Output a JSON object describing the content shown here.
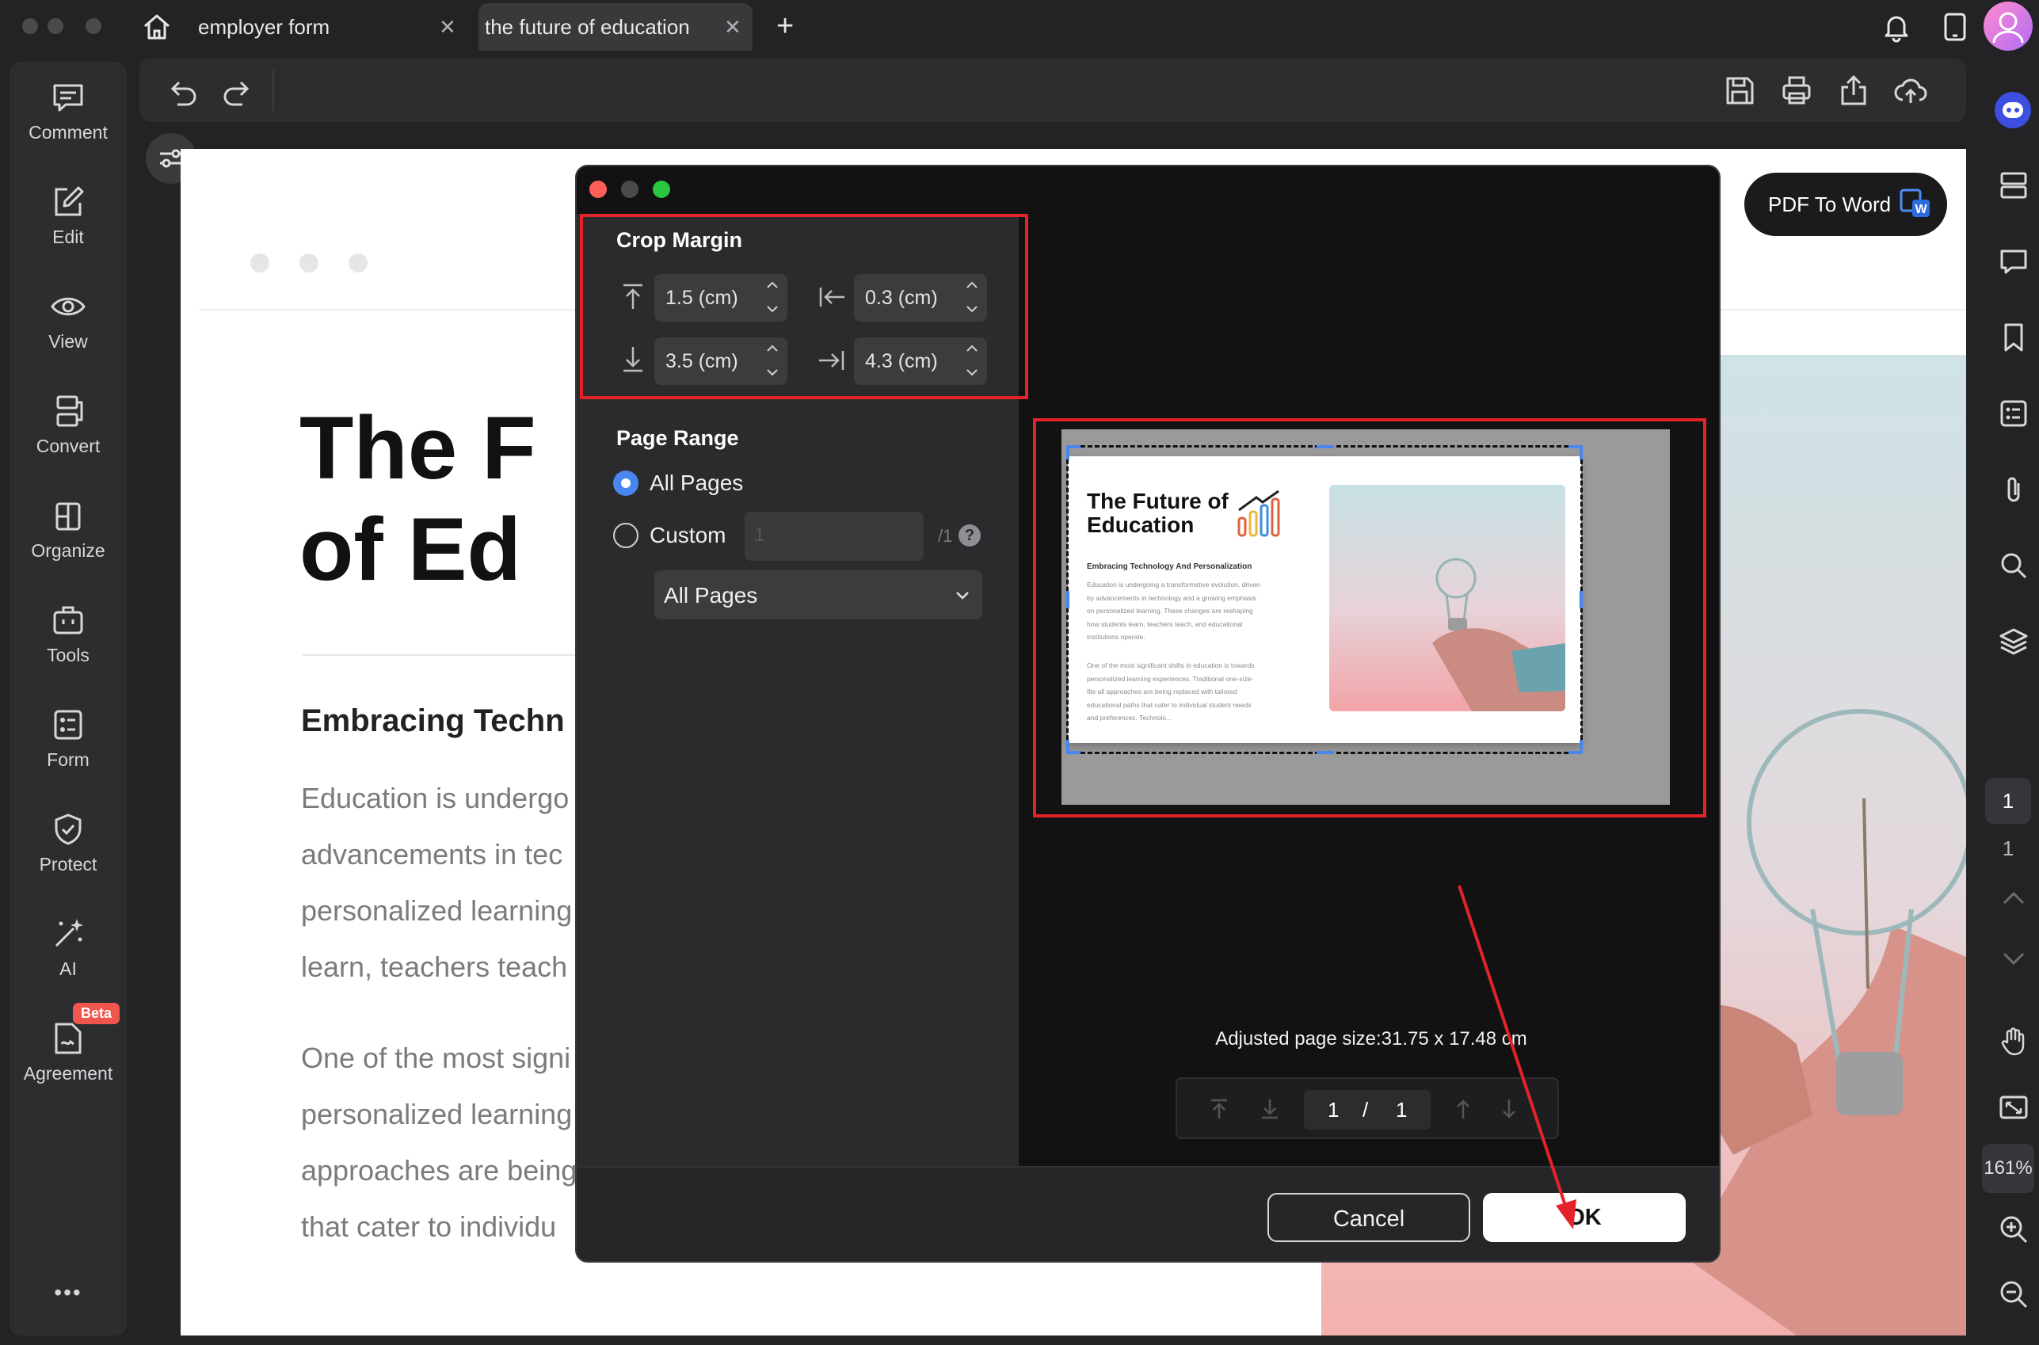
{
  "tabs": [
    {
      "title": "employer form",
      "close": "✕"
    },
    {
      "title": "the future of education",
      "close": "✕"
    }
  ],
  "new_tab": "+",
  "sidebar": {
    "items": [
      {
        "label": "Comment",
        "icon": "comment-icon"
      },
      {
        "label": "Edit",
        "icon": "edit-icon"
      },
      {
        "label": "View",
        "icon": "view-icon"
      },
      {
        "label": "Convert",
        "icon": "convert-icon"
      },
      {
        "label": "Organize",
        "icon": "organize-icon"
      },
      {
        "label": "Tools",
        "icon": "tools-icon"
      },
      {
        "label": "Form",
        "icon": "form-icon"
      },
      {
        "label": "Protect",
        "icon": "protect-icon"
      },
      {
        "label": "AI",
        "icon": "ai-wand-icon"
      },
      {
        "label": "Agreement",
        "icon": "agreement-icon",
        "badge": "Beta"
      }
    ],
    "more": "•••"
  },
  "pdf_to_word": "PDF To Word",
  "document": {
    "title_line1": "The F",
    "title_line2": "of Ed",
    "heading": "Embracing Techn",
    "para1": [
      "Education is undergo",
      "advancements in tec",
      "personalized learning",
      "learn, teachers teach"
    ],
    "para2": [
      "One of the most signi",
      "personalized learning",
      "approaches are being",
      "that cater to individu"
    ]
  },
  "right_rail": {
    "page_current": "1",
    "page_total": "1",
    "zoom": "161%"
  },
  "dialog": {
    "crop_margin": {
      "heading": "Crop Margin",
      "top": "1.5 (cm)",
      "left": "0.3 (cm)",
      "bottom": "3.5 (cm)",
      "right": "4.3 (cm)"
    },
    "page_range": {
      "heading": "Page Range",
      "all_pages": "All Pages",
      "custom": "Custom",
      "custom_placeholder": "1",
      "custom_total": "/1",
      "help": "?",
      "subset_select": "All Pages",
      "selected": "all_pages"
    },
    "preview": {
      "thumb_title": "The Future of Education",
      "thumb_subtitle": "Embracing Technology And Personalization",
      "thumb_text1": "Education is undergoing a transformative evolution, driven by advancements in technology and a growing emphasis on personalized learning. These changes are reshaping how students learn, teachers teach, and educational institutions operate.",
      "thumb_text2": "One of the most significant shifts in education is towards personalized learning experiences. Traditional one-size-fits-all approaches are being replaced with tailored educational paths that cater to individual student needs and preferences. Technolo..."
    },
    "adjusted_size": "Adjusted page size:31.75 x 17.48 cm",
    "pager": {
      "current": "1",
      "sep": "/",
      "total": "1"
    },
    "cancel": "Cancel",
    "ok": "OK"
  },
  "colors": {
    "accent_red": "#e3232a",
    "ok_bg": "#ffffff",
    "radio_blue": "#4a86f0"
  }
}
